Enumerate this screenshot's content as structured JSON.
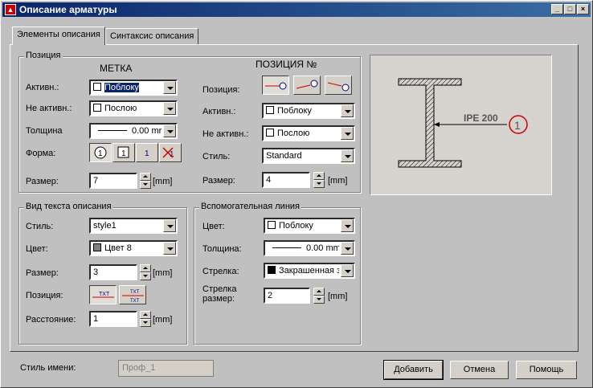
{
  "window": {
    "title": "Описание арматуры"
  },
  "tabs": [
    {
      "label": "Элементы описания"
    },
    {
      "label": "Синтаксис описания"
    }
  ],
  "position_group": {
    "title": "Позиция",
    "mark_header": "МЕТКА",
    "posnum_header": "ПОЗИЦИЯ №",
    "active_label": "Активн.:",
    "active_value": "Поблоку",
    "inactive_label": "Не активн.:",
    "inactive_value": "Послою",
    "thickness_label": "Толщина",
    "thickness_value": "0.00 mr",
    "form_label": "Форма:",
    "size_label": "Размер:",
    "size_value": "7",
    "size_unit": "[mm]",
    "r_position_label": "Позиция:",
    "r_active_label": "Активн.:",
    "r_active_value": "Поблоку",
    "r_inactive_label": "Не активн.:",
    "r_inactive_value": "Послою",
    "r_style_label": "Стиль:",
    "r_style_value": "Standard",
    "r_size_label": "Размер:",
    "r_size_value": "4",
    "r_size_unit": "[mm]"
  },
  "text_group": {
    "title": "Вид текста описания",
    "style_label": "Стиль:",
    "style_value": "style1",
    "color_label": "Цвет:",
    "color_value": "Цвет 8",
    "size_label": "Размер:",
    "size_value": "3",
    "size_unit": "[mm]",
    "position_label": "Позиция:",
    "distance_label": "Расстояние:",
    "distance_value": "1",
    "distance_unit": "[mm]"
  },
  "aux_group": {
    "title": "Вспомогательная линия",
    "color_label": "Цвет:",
    "color_value": "Поблоку",
    "thickness_label": "Толщина:",
    "thickness_value": "0.00 mm",
    "arrow_label": "Стрелка:",
    "arrow_value": "Закрашенная з",
    "arrow_size_label1": "Стрелка",
    "arrow_size_label2": "размер:",
    "arrow_size_value": "2",
    "arrow_size_unit": "[mm]"
  },
  "preview": {
    "profile_label": "IPE 200",
    "position_number": "1"
  },
  "footer": {
    "name_style_label": "Стиль имени:",
    "name_style_value": "Проф_1",
    "add_label": "Добавить",
    "cancel_label": "Отмена",
    "help_label": "Помощь"
  },
  "colors": {
    "title_bar": "#0a246a",
    "marker_red": "#cc0000",
    "color8_swatch": "#808080"
  }
}
